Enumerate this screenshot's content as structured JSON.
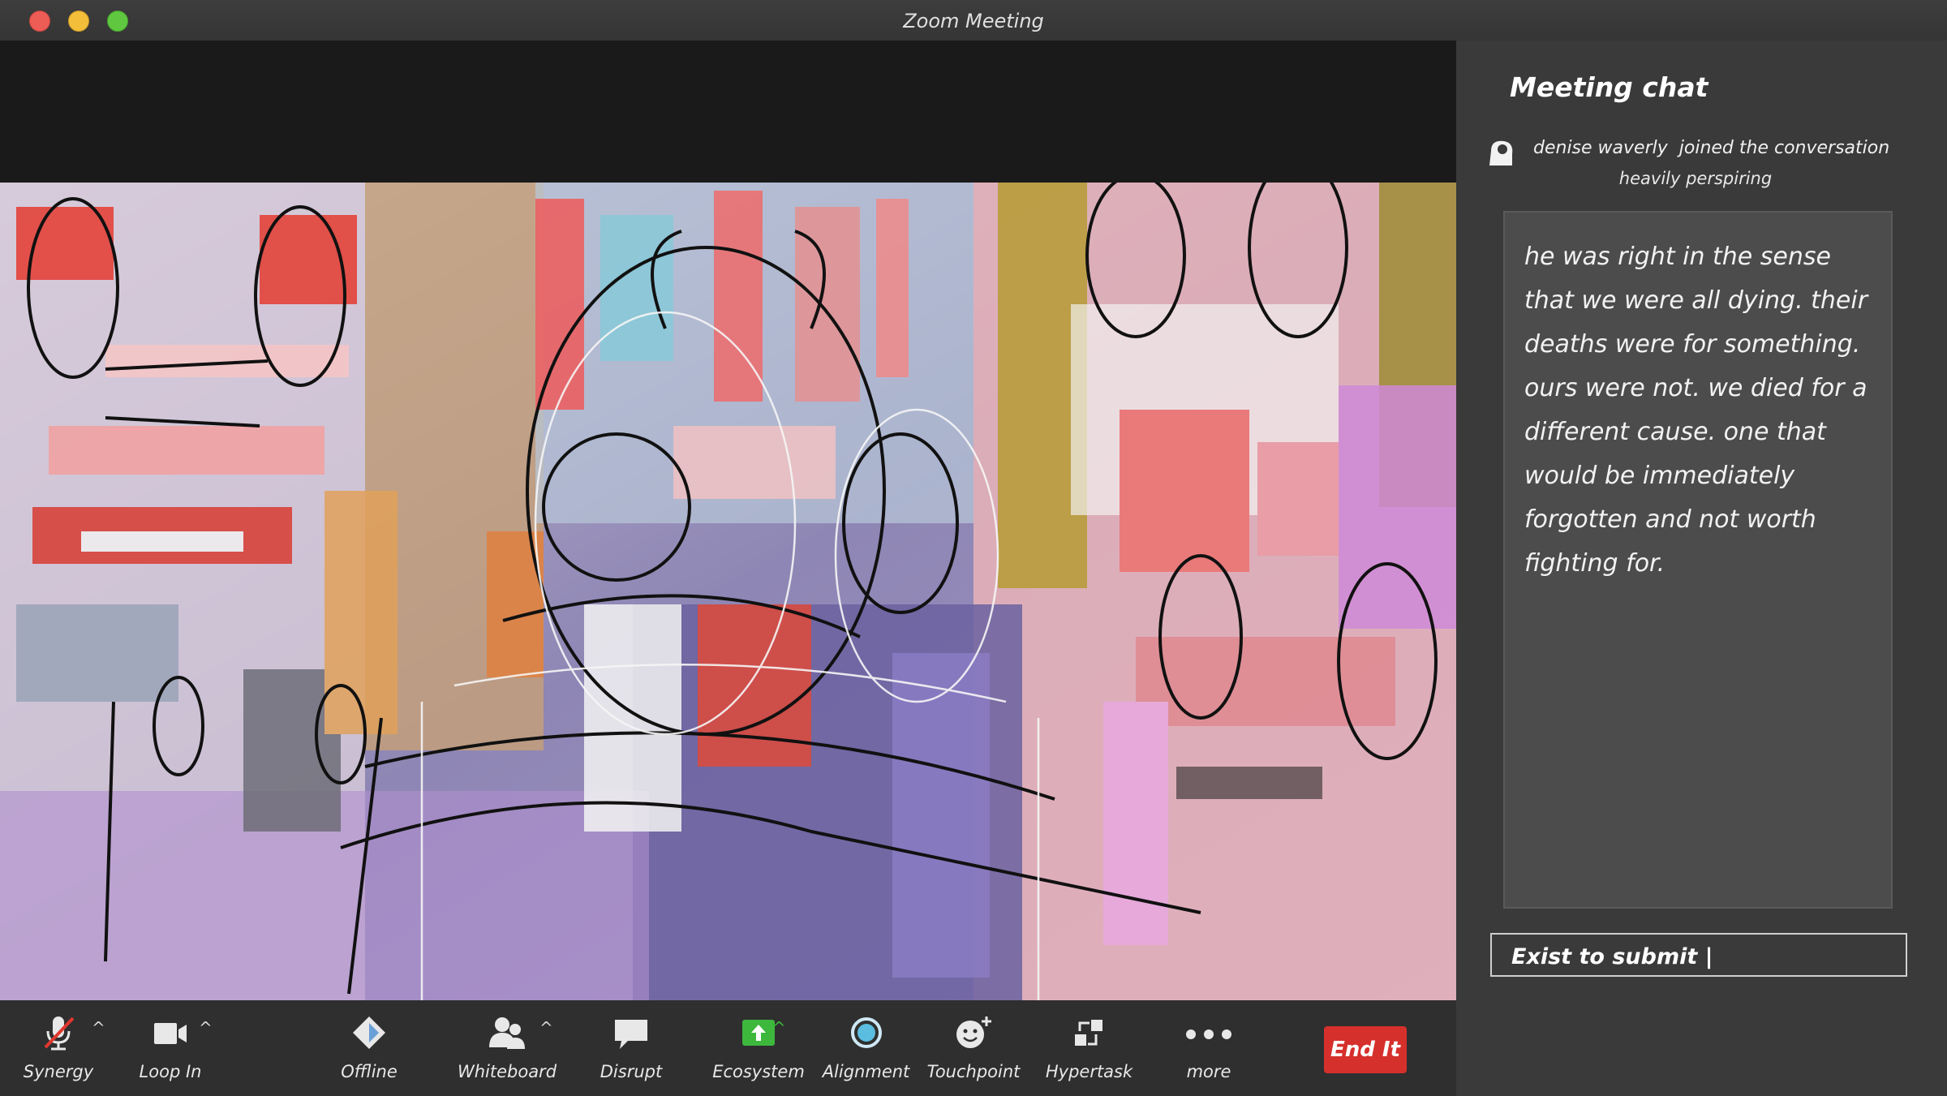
{
  "window": {
    "title": "Zoom Meeting"
  },
  "chat": {
    "title": "Meeting chat",
    "join_notice": {
      "user": "denise waverly",
      "action": "joined the conversation",
      "subtext": "heavily perspiring"
    },
    "message": "he was right in the sense that we were all dying. their deaths were for something. ours were not. we died for a different cause. one that would be immediately forgotten and not worth fighting for.",
    "input_value": "Exist to submit |"
  },
  "toolbar": {
    "items": [
      {
        "label": "Synergy",
        "icon": "microphone-muted-icon"
      },
      {
        "label": "Loop In",
        "icon": "video-camera-icon"
      },
      {
        "label": "Offline",
        "icon": "diamond-icon"
      },
      {
        "label": "Whiteboard",
        "icon": "participants-icon"
      },
      {
        "label": "Disrupt",
        "icon": "speech-bubble-icon"
      },
      {
        "label": "Ecosystem",
        "icon": "share-screen-icon"
      },
      {
        "label": "Alignment",
        "icon": "circle-icon"
      },
      {
        "label": "Touchpoint",
        "icon": "reaction-icon"
      },
      {
        "label": "Hypertask",
        "icon": "apps-icon"
      },
      {
        "label": "more",
        "icon": "more-dots-icon"
      }
    ],
    "end_label": "End It"
  },
  "colors": {
    "end_button": "#d6302c",
    "share_green": "#3db83d",
    "panel_bg": "#3a3a3a"
  }
}
